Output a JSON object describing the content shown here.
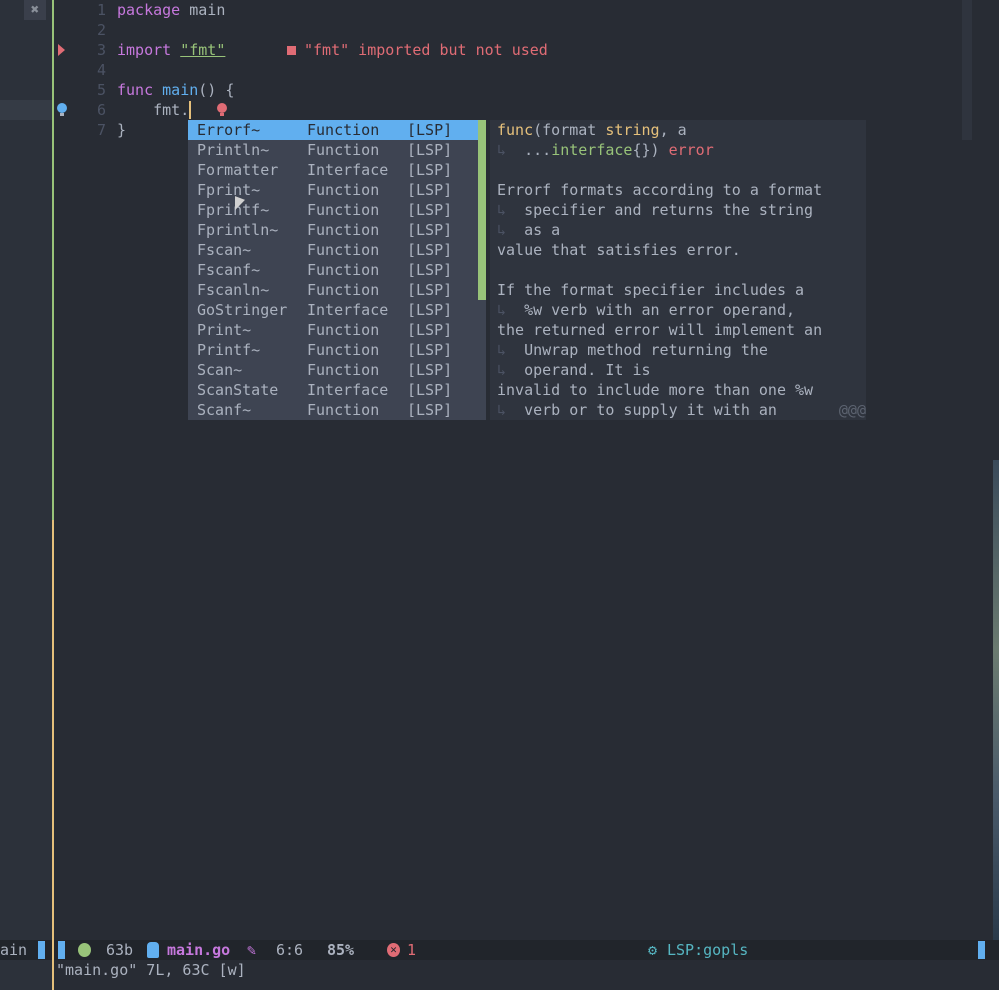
{
  "left_pane": {
    "close_icon": "close-icon",
    "status_text": "ain"
  },
  "editor": {
    "lines": [
      {
        "n": "1",
        "code": [
          {
            "t": "package",
            "c": "kw"
          },
          {
            "t": " main",
            "c": "plain"
          }
        ]
      },
      {
        "n": "2",
        "code": []
      },
      {
        "n": "3",
        "code": [
          {
            "t": "import",
            "c": "kw"
          },
          {
            "t": " ",
            "c": "plain"
          },
          {
            "t": "\"fmt\"",
            "c": "str"
          }
        ]
      },
      {
        "n": "4",
        "code": []
      },
      {
        "n": "5",
        "code": [
          {
            "t": "func",
            "c": "kw"
          },
          {
            "t": " ",
            "c": "plain"
          },
          {
            "t": "main",
            "c": "fn"
          },
          {
            "t": "() {",
            "c": "plain"
          }
        ]
      },
      {
        "n": "6",
        "code": [
          {
            "t": "    fmt.",
            "c": "plain"
          }
        ]
      },
      {
        "n": "7",
        "code": [
          {
            "t": "}",
            "c": "plain"
          }
        ]
      }
    ],
    "diagnostic": "\"fmt\" imported but not used"
  },
  "completion": {
    "items": [
      {
        "name": "Errorf~",
        "kind": "Function",
        "source": "[LSP]",
        "selected": true
      },
      {
        "name": "Println~",
        "kind": "Function",
        "source": "[LSP]"
      },
      {
        "name": "Formatter",
        "kind": "Interface",
        "source": "[LSP]"
      },
      {
        "name": "Fprint~",
        "kind": "Function",
        "source": "[LSP]"
      },
      {
        "name": "Fprintf~",
        "kind": "Function",
        "source": "[LSP]"
      },
      {
        "name": "Fprintln~",
        "kind": "Function",
        "source": "[LSP]"
      },
      {
        "name": "Fscan~",
        "kind": "Function",
        "source": "[LSP]"
      },
      {
        "name": "Fscanf~",
        "kind": "Function",
        "source": "[LSP]"
      },
      {
        "name": "Fscanln~",
        "kind": "Function",
        "source": "[LSP]"
      },
      {
        "name": "GoStringer",
        "kind": "Interface",
        "source": "[LSP]"
      },
      {
        "name": "Print~",
        "kind": "Function",
        "source": "[LSP]"
      },
      {
        "name": "Printf~",
        "kind": "Function",
        "source": "[LSP]"
      },
      {
        "name": "Scan~",
        "kind": "Function",
        "source": "[LSP]"
      },
      {
        "name": "ScanState",
        "kind": "Interface",
        "source": "[LSP]"
      },
      {
        "name": "Scanf~",
        "kind": "Function",
        "source": "[LSP]"
      }
    ]
  },
  "doc": {
    "lines": [
      [
        {
          "t": "func",
          "c": "y"
        },
        {
          "t": "(format ",
          "c": ""
        },
        {
          "t": "string",
          "c": "y"
        },
        {
          "t": ", a",
          "c": ""
        }
      ],
      [
        {
          "t": "↳",
          "c": "wrap"
        },
        {
          "t": "  ...",
          "c": ""
        },
        {
          "t": "interface",
          "c": "g"
        },
        {
          "t": "{}) ",
          "c": ""
        },
        {
          "t": "error",
          "c": "r"
        }
      ],
      [],
      [
        {
          "t": "Errorf formats according to a format",
          "c": ""
        }
      ],
      [
        {
          "t": "↳",
          "c": "wrap"
        },
        {
          "t": "  specifier and returns the string",
          "c": ""
        }
      ],
      [
        {
          "t": "↳",
          "c": "wrap"
        },
        {
          "t": "  as a",
          "c": ""
        }
      ],
      [
        {
          "t": "value that satisfies error.",
          "c": ""
        }
      ],
      [],
      [
        {
          "t": "If the format specifier includes a",
          "c": ""
        }
      ],
      [
        {
          "t": "↳",
          "c": "wrap"
        },
        {
          "t": "  %w verb with an error operand,",
          "c": ""
        }
      ],
      [
        {
          "t": "the returned error will implement an",
          "c": ""
        }
      ],
      [
        {
          "t": "↳",
          "c": "wrap"
        },
        {
          "t": "  Unwrap method returning the",
          "c": ""
        }
      ],
      [
        {
          "t": "↳",
          "c": "wrap"
        },
        {
          "t": "  operand. It is",
          "c": ""
        }
      ],
      [
        {
          "t": "invalid to include more than one %w",
          "c": ""
        }
      ],
      [
        {
          "t": "↳",
          "c": "wrap"
        },
        {
          "t": "  verb or to supply it with an",
          "c": ""
        }
      ]
    ],
    "more": "@@@"
  },
  "statusline": {
    "size": "63b",
    "filename": "main.go",
    "position": "6:6",
    "percent": "85%",
    "errors": "1",
    "lsp": "LSP:gopls"
  },
  "cmdline": "\"main.go\" 7L, 63C [w]",
  "colors": {
    "background": "#282c34",
    "accent": "#61afef",
    "error": "#e06c75",
    "string": "#98c379",
    "keyword": "#c678dd",
    "lsp": "#56b6c2"
  }
}
